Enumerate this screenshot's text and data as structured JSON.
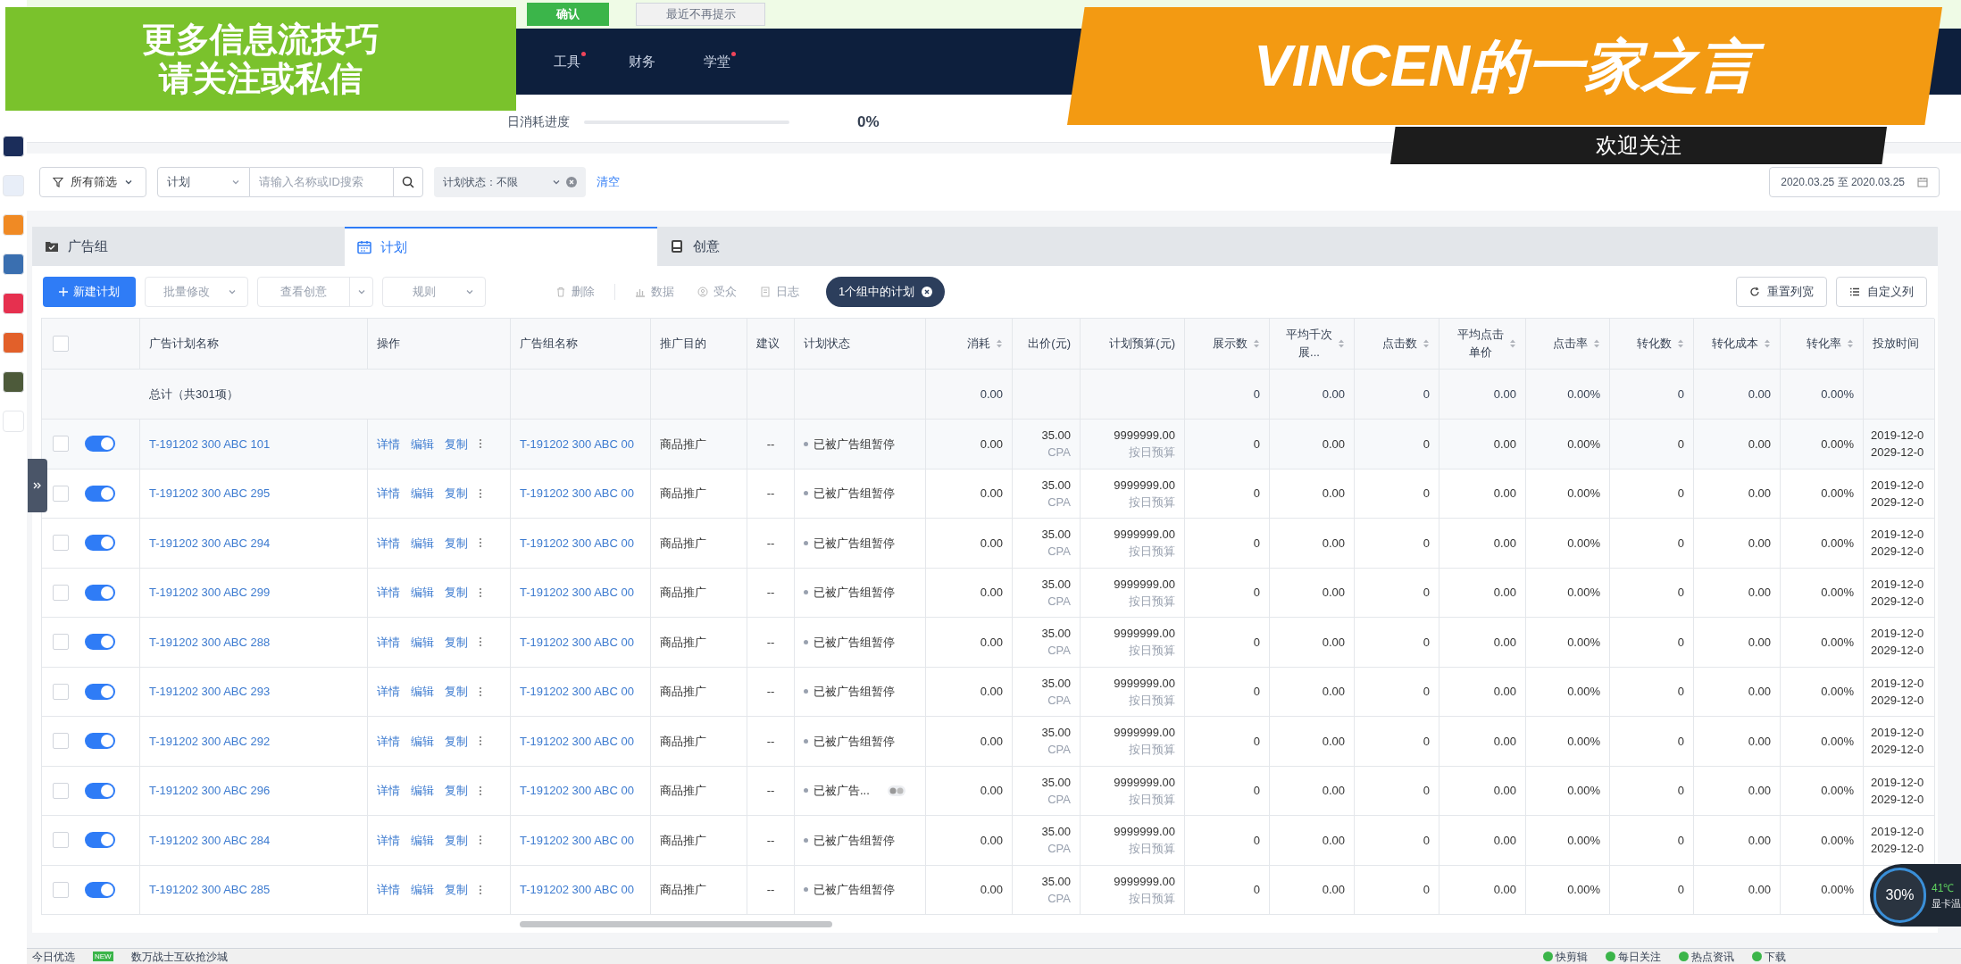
{
  "notice_bar": {
    "buttons": [
      {
        "label": "确认",
        "kind": "primary"
      },
      {
        "label": "最近不再提示",
        "kind": "secondary"
      }
    ]
  },
  "nav": {
    "items": [
      {
        "label": "工具",
        "badge": true
      },
      {
        "label": "财务",
        "badge": false
      },
      {
        "label": "学堂",
        "badge": true
      }
    ]
  },
  "stats": {
    "progress_label": "日消耗进度",
    "level": 0,
    "reading": "0%"
  },
  "filters": {
    "all_filter": "所有筛选",
    "scope": "计划",
    "search_placeholder": "请输入名称或ID搜索",
    "status": "计划状态：不限",
    "clear": "清空",
    "date_range": "2020.03.25 至 2020.03.25"
  },
  "tabs": [
    {
      "label": "广告组",
      "selected": false
    },
    {
      "label": "计划",
      "selected": true
    },
    {
      "label": "创意",
      "selected": false
    }
  ],
  "toolbar": {
    "left": [
      {
        "label": "新建计划",
        "kind": "primary",
        "disabled": false
      },
      {
        "label": "批量修改",
        "kind": "dropdown",
        "disabled": true
      },
      {
        "label": "查看创意",
        "kind": "split",
        "disabled": true
      },
      {
        "label": "规则",
        "kind": "dropdown",
        "disabled": true
      },
      {
        "label": "删除",
        "kind": "delete",
        "disabled": true
      },
      {
        "label": "数据",
        "kind": "data",
        "disabled": true
      },
      {
        "label": "受众",
        "kind": "audience",
        "disabled": true
      },
      {
        "label": "日志",
        "kind": "log",
        "disabled": true
      }
    ],
    "chip": "1个组中的计划",
    "right": [
      {
        "label": "重置列宽",
        "kind": "reset"
      },
      {
        "label": "自定义列",
        "kind": "columns"
      }
    ]
  },
  "table": {
    "header_checked": false,
    "columns": [
      {
        "label": "广告计划名称",
        "sortable": false
      },
      {
        "label": "操作",
        "sortable": false
      },
      {
        "label": "广告组名称",
        "sortable": false
      },
      {
        "label": "推广目的",
        "sortable": false
      },
      {
        "label": "建议",
        "sortable": false
      },
      {
        "label": "计划状态",
        "sortable": false
      },
      {
        "label": "消耗",
        "sortable": true
      },
      {
        "label": "出价(元)",
        "sortable": false
      },
      {
        "label": "计划预算(元)",
        "sortable": false
      },
      {
        "label": "展示数",
        "sortable": true
      },
      {
        "label": "平均千次展...",
        "sortable": true
      },
      {
        "label": "点击数",
        "sortable": true
      },
      {
        "label": "平均点击单价",
        "sortable": true
      },
      {
        "label": "点击率",
        "sortable": true
      },
      {
        "label": "转化数",
        "sortable": true
      },
      {
        "label": "转化成本",
        "sortable": true
      },
      {
        "label": "转化率",
        "sortable": true
      },
      {
        "label": "投放时间",
        "sortable": false
      }
    ],
    "total": {
      "label": "总计（共301项）",
      "cost": "0.00",
      "impressions": "0",
      "cpm": "0.00",
      "clicks": "0",
      "cpc": "0.00",
      "ctr": "0.00%",
      "conversions": "0",
      "conv_cost": "0.00",
      "conv_rate": "0.00%"
    },
    "rows": [
      {
        "checked": false,
        "enabled": true,
        "name": "T-191202 300 ABC 101",
        "actions": [
          "详情",
          "编辑",
          "复制"
        ],
        "group": "T-191202 300 ABC 00",
        "purpose": "商品推广",
        "suggestion": "--",
        "status": "已被广告组暂停",
        "status_badge": false,
        "cost": "0.00",
        "bid": "35.00",
        "bid_type": "CPA",
        "budget": "9999999.00",
        "budget_type": "按日预算",
        "impressions": "0",
        "cpm": "0.00",
        "clicks": "0",
        "cpc": "0.00",
        "ctr": "0.00%",
        "conversions": "0",
        "conv_cost": "0.00",
        "conv_rate": "0.00%",
        "start": "2019-12-0",
        "end": "2029-12-0"
      },
      {
        "checked": false,
        "enabled": true,
        "name": "T-191202 300 ABC 295",
        "actions": [
          "详情",
          "编辑",
          "复制"
        ],
        "group": "T-191202 300 ABC 00",
        "purpose": "商品推广",
        "suggestion": "--",
        "status": "已被广告组暂停",
        "status_badge": false,
        "cost": "0.00",
        "bid": "35.00",
        "bid_type": "CPA",
        "budget": "9999999.00",
        "budget_type": "按日预算",
        "impressions": "0",
        "cpm": "0.00",
        "clicks": "0",
        "cpc": "0.00",
        "ctr": "0.00%",
        "conversions": "0",
        "conv_cost": "0.00",
        "conv_rate": "0.00%",
        "start": "2019-12-0",
        "end": "2029-12-0"
      },
      {
        "checked": false,
        "enabled": true,
        "name": "T-191202 300 ABC 294",
        "actions": [
          "详情",
          "编辑",
          "复制"
        ],
        "group": "T-191202 300 ABC 00",
        "purpose": "商品推广",
        "suggestion": "--",
        "status": "已被广告组暂停",
        "status_badge": false,
        "cost": "0.00",
        "bid": "35.00",
        "bid_type": "CPA",
        "budget": "9999999.00",
        "budget_type": "按日预算",
        "impressions": "0",
        "cpm": "0.00",
        "clicks": "0",
        "cpc": "0.00",
        "ctr": "0.00%",
        "conversions": "0",
        "conv_cost": "0.00",
        "conv_rate": "0.00%",
        "start": "2019-12-0",
        "end": "2029-12-0"
      },
      {
        "checked": false,
        "enabled": true,
        "name": "T-191202 300 ABC 299",
        "actions": [
          "详情",
          "编辑",
          "复制"
        ],
        "group": "T-191202 300 ABC 00",
        "purpose": "商品推广",
        "suggestion": "--",
        "status": "已被广告组暂停",
        "status_badge": false,
        "cost": "0.00",
        "bid": "35.00",
        "bid_type": "CPA",
        "budget": "9999999.00",
        "budget_type": "按日预算",
        "impressions": "0",
        "cpm": "0.00",
        "clicks": "0",
        "cpc": "0.00",
        "ctr": "0.00%",
        "conversions": "0",
        "conv_cost": "0.00",
        "conv_rate": "0.00%",
        "start": "2019-12-0",
        "end": "2029-12-0"
      },
      {
        "checked": false,
        "enabled": true,
        "name": "T-191202 300 ABC 288",
        "actions": [
          "详情",
          "编辑",
          "复制"
        ],
        "group": "T-191202 300 ABC 00",
        "purpose": "商品推广",
        "suggestion": "--",
        "status": "已被广告组暂停",
        "status_badge": false,
        "cost": "0.00",
        "bid": "35.00",
        "bid_type": "CPA",
        "budget": "9999999.00",
        "budget_type": "按日预算",
        "impressions": "0",
        "cpm": "0.00",
        "clicks": "0",
        "cpc": "0.00",
        "ctr": "0.00%",
        "conversions": "0",
        "conv_cost": "0.00",
        "conv_rate": "0.00%",
        "start": "2019-12-0",
        "end": "2029-12-0"
      },
      {
        "checked": false,
        "enabled": true,
        "name": "T-191202 300 ABC 293",
        "actions": [
          "详情",
          "编辑",
          "复制"
        ],
        "group": "T-191202 300 ABC 00",
        "purpose": "商品推广",
        "suggestion": "--",
        "status": "已被广告组暂停",
        "status_badge": false,
        "cost": "0.00",
        "bid": "35.00",
        "bid_type": "CPA",
        "budget": "9999999.00",
        "budget_type": "按日预算",
        "impressions": "0",
        "cpm": "0.00",
        "clicks": "0",
        "cpc": "0.00",
        "ctr": "0.00%",
        "conversions": "0",
        "conv_cost": "0.00",
        "conv_rate": "0.00%",
        "start": "2019-12-0",
        "end": "2029-12-0"
      },
      {
        "checked": false,
        "enabled": true,
        "name": "T-191202 300 ABC 292",
        "actions": [
          "详情",
          "编辑",
          "复制"
        ],
        "group": "T-191202 300 ABC 00",
        "purpose": "商品推广",
        "suggestion": "--",
        "status": "已被广告组暂停",
        "status_badge": false,
        "cost": "0.00",
        "bid": "35.00",
        "bid_type": "CPA",
        "budget": "9999999.00",
        "budget_type": "按日预算",
        "impressions": "0",
        "cpm": "0.00",
        "clicks": "0",
        "cpc": "0.00",
        "ctr": "0.00%",
        "conversions": "0",
        "conv_cost": "0.00",
        "conv_rate": "0.00%",
        "start": "2019-12-0",
        "end": "2029-12-0"
      },
      {
        "checked": false,
        "enabled": true,
        "name": "T-191202 300 ABC 296",
        "actions": [
          "详情",
          "编辑",
          "复制"
        ],
        "group": "T-191202 300 ABC 00",
        "purpose": "商品推广",
        "suggestion": "--",
        "status": "已被广告...",
        "status_badge": true,
        "cost": "0.00",
        "bid": "35.00",
        "bid_type": "CPA",
        "budget": "9999999.00",
        "budget_type": "按日预算",
        "impressions": "0",
        "cpm": "0.00",
        "clicks": "0",
        "cpc": "0.00",
        "ctr": "0.00%",
        "conversions": "0",
        "conv_cost": "0.00",
        "conv_rate": "0.00%",
        "start": "2019-12-0",
        "end": "2029-12-0"
      },
      {
        "checked": false,
        "enabled": true,
        "name": "T-191202 300 ABC 284",
        "actions": [
          "详情",
          "编辑",
          "复制"
        ],
        "group": "T-191202 300 ABC 00",
        "purpose": "商品推广",
        "suggestion": "--",
        "status": "已被广告组暂停",
        "status_badge": false,
        "cost": "0.00",
        "bid": "35.00",
        "bid_type": "CPA",
        "budget": "9999999.00",
        "budget_type": "按日预算",
        "impressions": "0",
        "cpm": "0.00",
        "clicks": "0",
        "cpc": "0.00",
        "ctr": "0.00%",
        "conversions": "0",
        "conv_cost": "0.00",
        "conv_rate": "0.00%",
        "start": "2019-12-0",
        "end": "2029-12-0"
      },
      {
        "checked": false,
        "enabled": true,
        "name": "T-191202 300 ABC 285",
        "actions": [
          "详情",
          "编辑",
          "复制"
        ],
        "group": "T-191202 300 ABC 00",
        "purpose": "商品推广",
        "suggestion": "--",
        "status": "已被广告组暂停",
        "status_badge": false,
        "cost": "0.00",
        "bid": "35.00",
        "bid_type": "CPA",
        "budget": "9999999.00",
        "budget_type": "按日预算",
        "impressions": "0",
        "cpm": "0.00",
        "clicks": "0",
        "cpc": "0.00",
        "ctr": "0.00%",
        "conversions": "0",
        "conv_cost": "0.00",
        "conv_rate": "0.00%"
      }
    ]
  },
  "taskbar": {
    "left": [
      {
        "label": "今日优选"
      },
      {
        "label": "数万战士互砍抢沙城",
        "new_badge": "NEW"
      }
    ],
    "right": [
      "快剪辑",
      "每日关注",
      "热点资讯",
      "下载"
    ]
  },
  "widget": {
    "gauge": "30%",
    "temperature": "41℃",
    "temperature_label": "显卡温"
  },
  "overlays": {
    "promo_box": [
      "更多信息流技巧",
      "请关注或私信"
    ],
    "banner": {
      "title": "VINCEN的一家之言",
      "subtitle": "欢迎关注"
    }
  }
}
